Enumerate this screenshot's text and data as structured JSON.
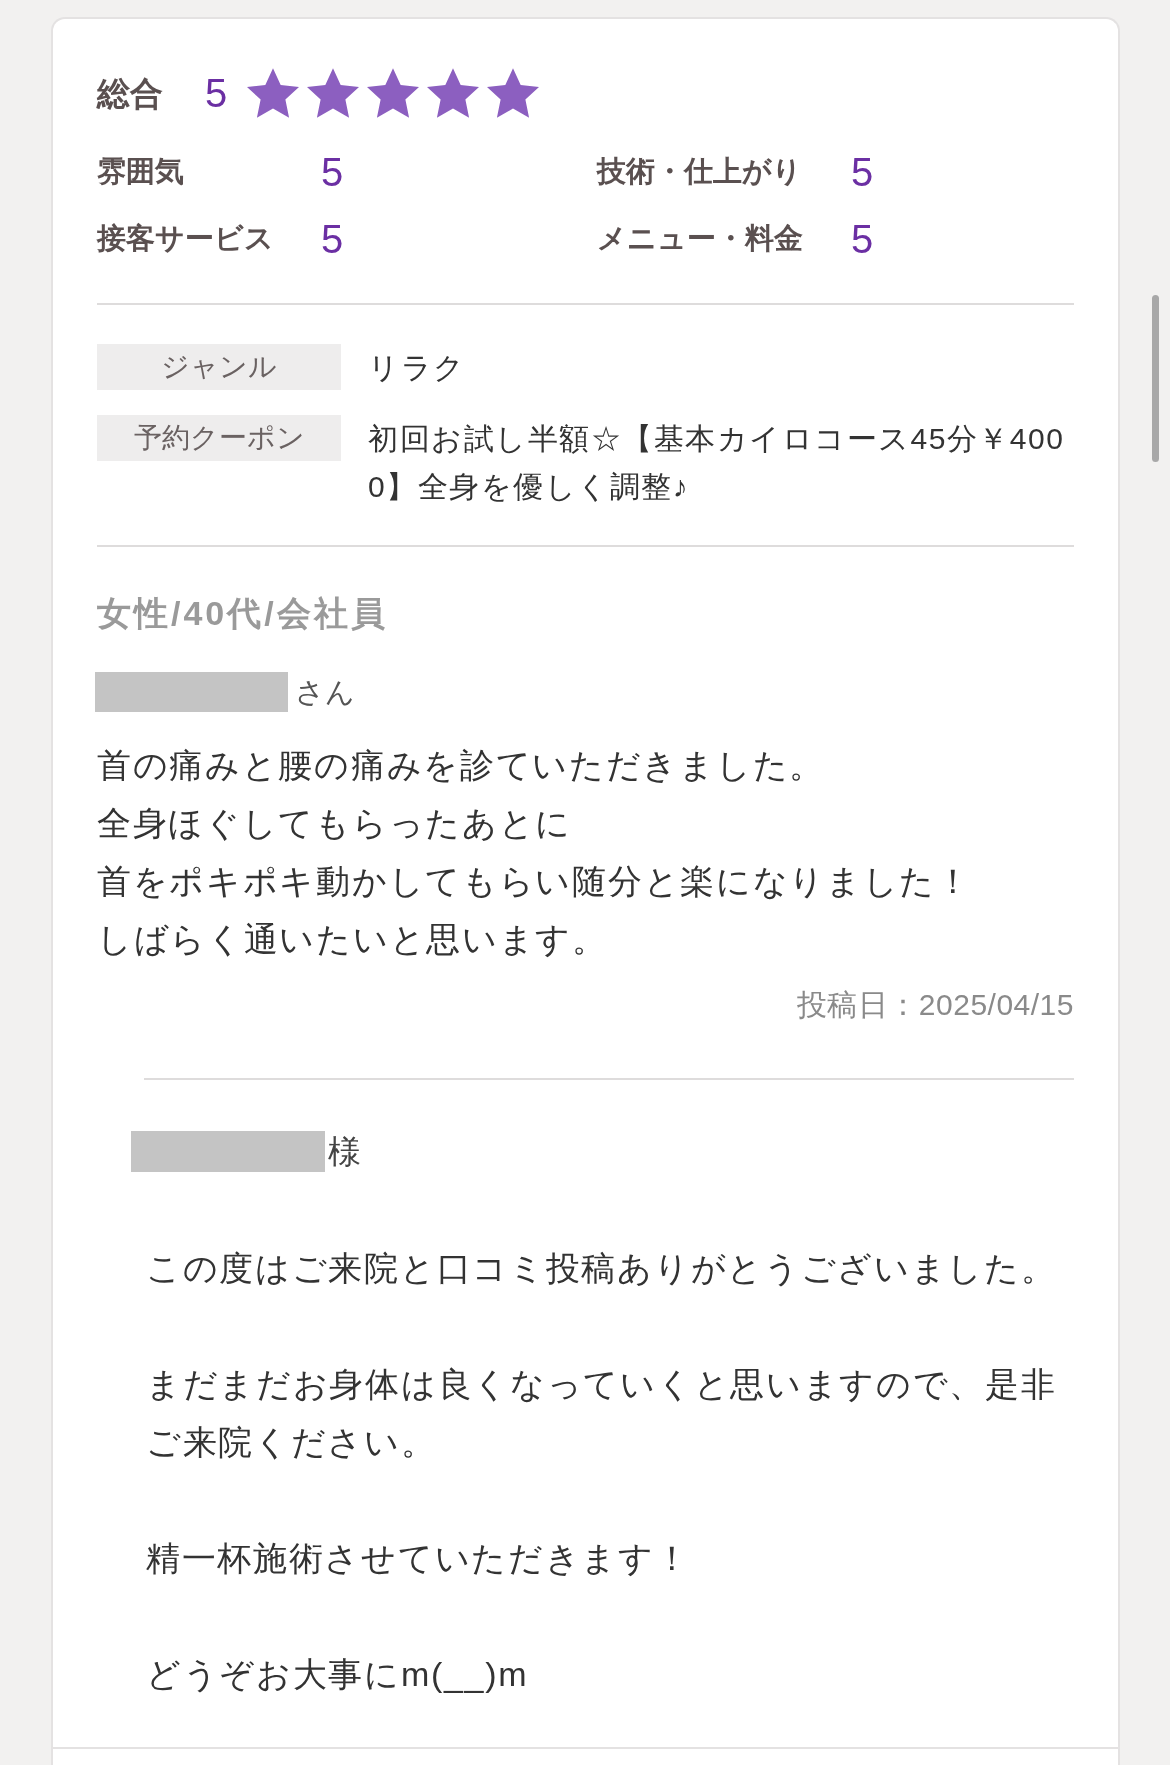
{
  "overall": {
    "label": "総合",
    "score": "5",
    "stars": 5
  },
  "ratings": [
    {
      "label": "雰囲気",
      "score": "5"
    },
    {
      "label": "技術・仕上がり",
      "score": "5"
    },
    {
      "label": "接客サービス",
      "score": "5"
    },
    {
      "label": "メニュー・料金",
      "score": "5"
    }
  ],
  "details": [
    {
      "label": "ジャンル",
      "value": "リラク"
    },
    {
      "label": "予約クーポン",
      "value": "初回お試し半額☆【基本カイロコース45分￥4000】全身を優しく調整♪"
    }
  ],
  "reviewer": {
    "profile": "女性/40代/会社員",
    "name_redacted": true,
    "honorific": "さん"
  },
  "review": {
    "lines": [
      "首の痛みと腰の痛みを診ていただきました。",
      "全身ほぐしてもらったあとに",
      "首をポキポキ動かしてもらい随分と楽になりました！",
      "しばらく通いたいと思います。"
    ],
    "posted": "投稿日：2025/04/15"
  },
  "reply": {
    "name_redacted": true,
    "honorific": "様",
    "paragraphs": [
      "この度はご来院と口コミ投稿ありがとうございました。",
      "まだまだお身体は良くなっていくと思いますので、是非ご来院ください。",
      "精一杯施術させていただきます！",
      "どうぞお大事にm(__)m"
    ]
  }
}
